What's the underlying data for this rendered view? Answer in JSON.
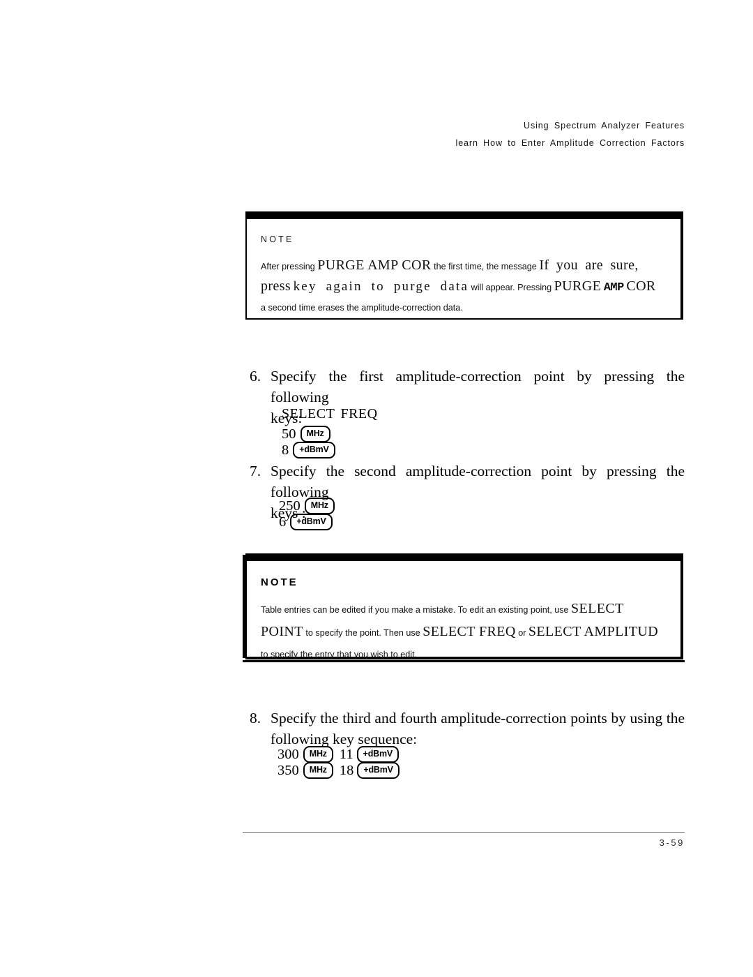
{
  "header": {
    "line1": "Using Spectrum Analyzer Features",
    "line2": "learn How to Enter Amplitude Correction Factors"
  },
  "note1": {
    "title": "NOTE",
    "seg1": "After pressing",
    "seg2": "PURGE AMP COR",
    "seg3": "the first time, the message",
    "seg4": "If you are sure, press",
    "seg5": "key again to purge data",
    "seg6": "will appear. Pressing",
    "seg7": "PURGE",
    "seg8": "AMP",
    "seg9": "COR",
    "seg10": "a second time",
    "seg11": "erases the amplitude-correction data."
  },
  "note2": {
    "title": "NOTE",
    "seg1": "Table entries can be edited if you make a mistake. To edit an existing point, use",
    "seg2": "SELECT POINT",
    "seg3": "to specify the point. Then use",
    "seg4": "SELECT FREQ",
    "seg5": "or",
    "seg6": "SELECT AMPLITUD",
    "seg7": "to specify the entry that you wish to edit."
  },
  "steps": [
    {
      "number": "6.",
      "line1": "Specify the first amplitude-correction point by pressing the following",
      "line2": "keys:"
    },
    {
      "number": "7.",
      "line1": "Specify the second amplitude-correction point by pressing the following",
      "line2": "keys :"
    },
    {
      "number": "8.",
      "line1": "Specify the third and fourth amplitude-correction points by using the",
      "line2": "following key sequence:"
    }
  ],
  "keys6": {
    "softkey": "SELECT FREQ",
    "freq_value": "50",
    "freq_unit": "MHz",
    "ampl_value": "8",
    "ampl_unit": "+dBmV"
  },
  "keys7": {
    "freq_value": "250",
    "freq_unit": "MHz",
    "ampl_value": "6",
    "ampl_unit": "+dBmV"
  },
  "keys8": {
    "row1_freq": "300",
    "row1_freq_unit": "MHz",
    "row1_ampl": "11",
    "row1_ampl_unit": "+dBmV",
    "row2_freq": "350",
    "row2_freq_unit": "MHz",
    "row2_ampl": "18",
    "row2_ampl_unit": "+dBmV"
  },
  "footer": {
    "page_number": "3-59"
  }
}
